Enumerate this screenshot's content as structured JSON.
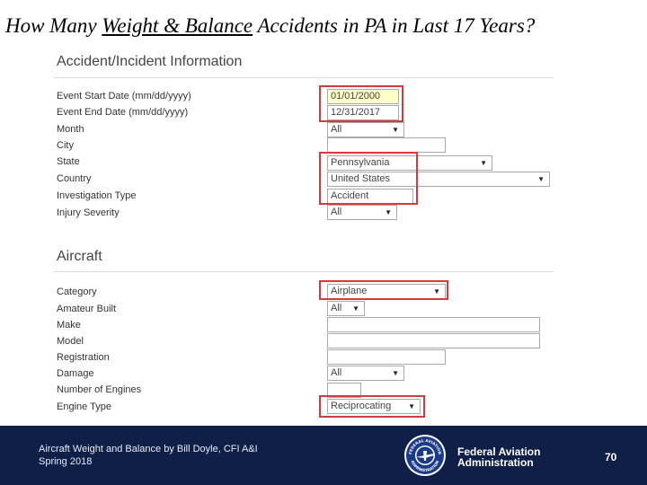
{
  "slide": {
    "title_before": "How Many ",
    "title_underlined": "Weight & Balance",
    "title_after": " Accidents in PA in Last 17 Years?"
  },
  "accident_section": {
    "heading": "Accident/Incident Information",
    "fields": {
      "event_start": {
        "label": "Event Start Date (mm/dd/yyyy)",
        "value": "01/01/2000"
      },
      "event_end": {
        "label": "Event End Date (mm/dd/yyyy)",
        "value": "12/31/2017"
      },
      "month": {
        "label": "Month",
        "value": "All"
      },
      "city": {
        "label": "City",
        "value": ""
      },
      "state": {
        "label": "State",
        "value": "Pennsylvania"
      },
      "country": {
        "label": "Country",
        "value": "United States"
      },
      "investigation_type": {
        "label": "Investigation Type",
        "value": "Accident"
      },
      "injury_severity": {
        "label": "Injury Severity",
        "value": "All"
      }
    }
  },
  "aircraft_section": {
    "heading": "Aircraft",
    "fields": {
      "category": {
        "label": "Category",
        "value": "Airplane"
      },
      "amateur_built": {
        "label": "Amateur Built",
        "value": "All"
      },
      "make": {
        "label": "Make",
        "value": ""
      },
      "model": {
        "label": "Model",
        "value": ""
      },
      "registration": {
        "label": "Registration",
        "value": ""
      },
      "damage": {
        "label": "Damage",
        "value": "All"
      },
      "number_of_engines": {
        "label": "Number of Engines",
        "value": ""
      },
      "engine_type": {
        "label": "Engine Type",
        "value": "Reciprocating"
      }
    }
  },
  "footer": {
    "presentation_line1": "Aircraft Weight and Balance by Bill Doyle, CFI A&I",
    "presentation_line2": "Spring 2018",
    "seal_text_top": "FEDERAL AVIATION",
    "seal_text_bottom": "ADMINISTRATION",
    "agency_line1": "Federal Aviation",
    "agency_line2": "Administration",
    "page_number": "70"
  },
  "colors": {
    "highlight": "#d63a3a",
    "footer_bg": "#0f1f47",
    "date_field_bg": "#fefec8"
  },
  "icons": {
    "dropdown": "triangle-down",
    "seal": "faa-seal"
  }
}
